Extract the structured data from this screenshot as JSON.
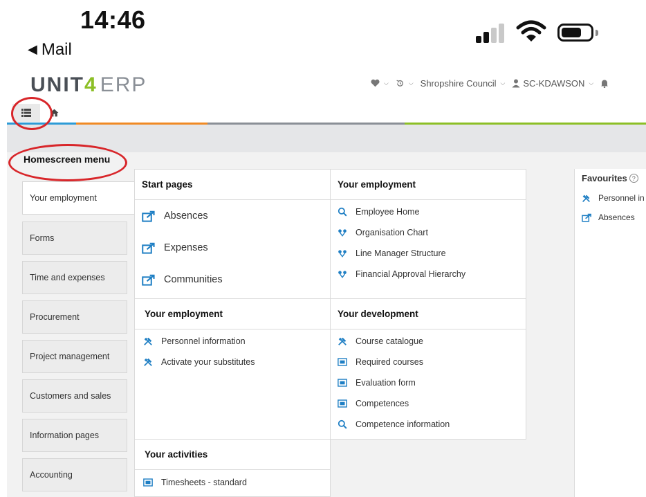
{
  "status_bar": {
    "time": "14:46",
    "back_label": "Mail",
    "back_arrow": "◀"
  },
  "header": {
    "logo_part1": "UNIT",
    "logo_part2": "4",
    "logo_part3": "ERP",
    "org": "Shropshire Council",
    "user": "SC-KDAWSON"
  },
  "homescreen_title": "Homescreen menu",
  "left_menu": [
    {
      "label": "Your employment",
      "active": true
    },
    {
      "label": "Forms"
    },
    {
      "label": "Time and expenses"
    },
    {
      "label": "Procurement"
    },
    {
      "label": "Project management"
    },
    {
      "label": "Customers and sales"
    },
    {
      "label": "Information pages"
    },
    {
      "label": "Accounting"
    }
  ],
  "sections": {
    "start_pages": {
      "title": "Start pages",
      "items": [
        {
          "label": "Absences",
          "icon": "external-link-icon"
        },
        {
          "label": "Expenses",
          "icon": "external-link-icon"
        },
        {
          "label": "Communities",
          "icon": "external-link-icon"
        }
      ]
    },
    "your_employment_right": {
      "title": "Your employment",
      "items": [
        {
          "label": "Employee Home",
          "icon": "search-icon"
        },
        {
          "label": "Organisation Chart",
          "icon": "hierarchy-icon"
        },
        {
          "label": "Line Manager Structure",
          "icon": "hierarchy-icon"
        },
        {
          "label": "Financial Approval Hierarchy",
          "icon": "hierarchy-icon"
        }
      ]
    },
    "your_employment_left": {
      "title": "Your employment",
      "items": [
        {
          "label": "Personnel information",
          "icon": "tools-icon"
        },
        {
          "label": "Activate your substitutes",
          "icon": "tools-icon"
        }
      ]
    },
    "your_development": {
      "title": "Your development",
      "items": [
        {
          "label": "Course catalogue",
          "icon": "tools-icon"
        },
        {
          "label": "Required courses",
          "icon": "form-icon"
        },
        {
          "label": "Evaluation form",
          "icon": "form-icon"
        },
        {
          "label": "Competences",
          "icon": "form-icon"
        },
        {
          "label": "Competence information",
          "icon": "search-icon"
        }
      ]
    },
    "your_activities": {
      "title": "Your activities",
      "items": [
        {
          "label": "Timesheets - standard",
          "icon": "form-icon"
        }
      ]
    }
  },
  "favourites": {
    "title": "Favourites",
    "help": "?",
    "items": [
      {
        "label": "Personnel in",
        "icon": "tools-icon"
      },
      {
        "label": "Absences",
        "icon": "external-link-icon"
      }
    ]
  },
  "colors": {
    "brand_green": "#8cbf26",
    "annotation_red": "#d8262a",
    "icon_blue": "#1f7fc4"
  }
}
